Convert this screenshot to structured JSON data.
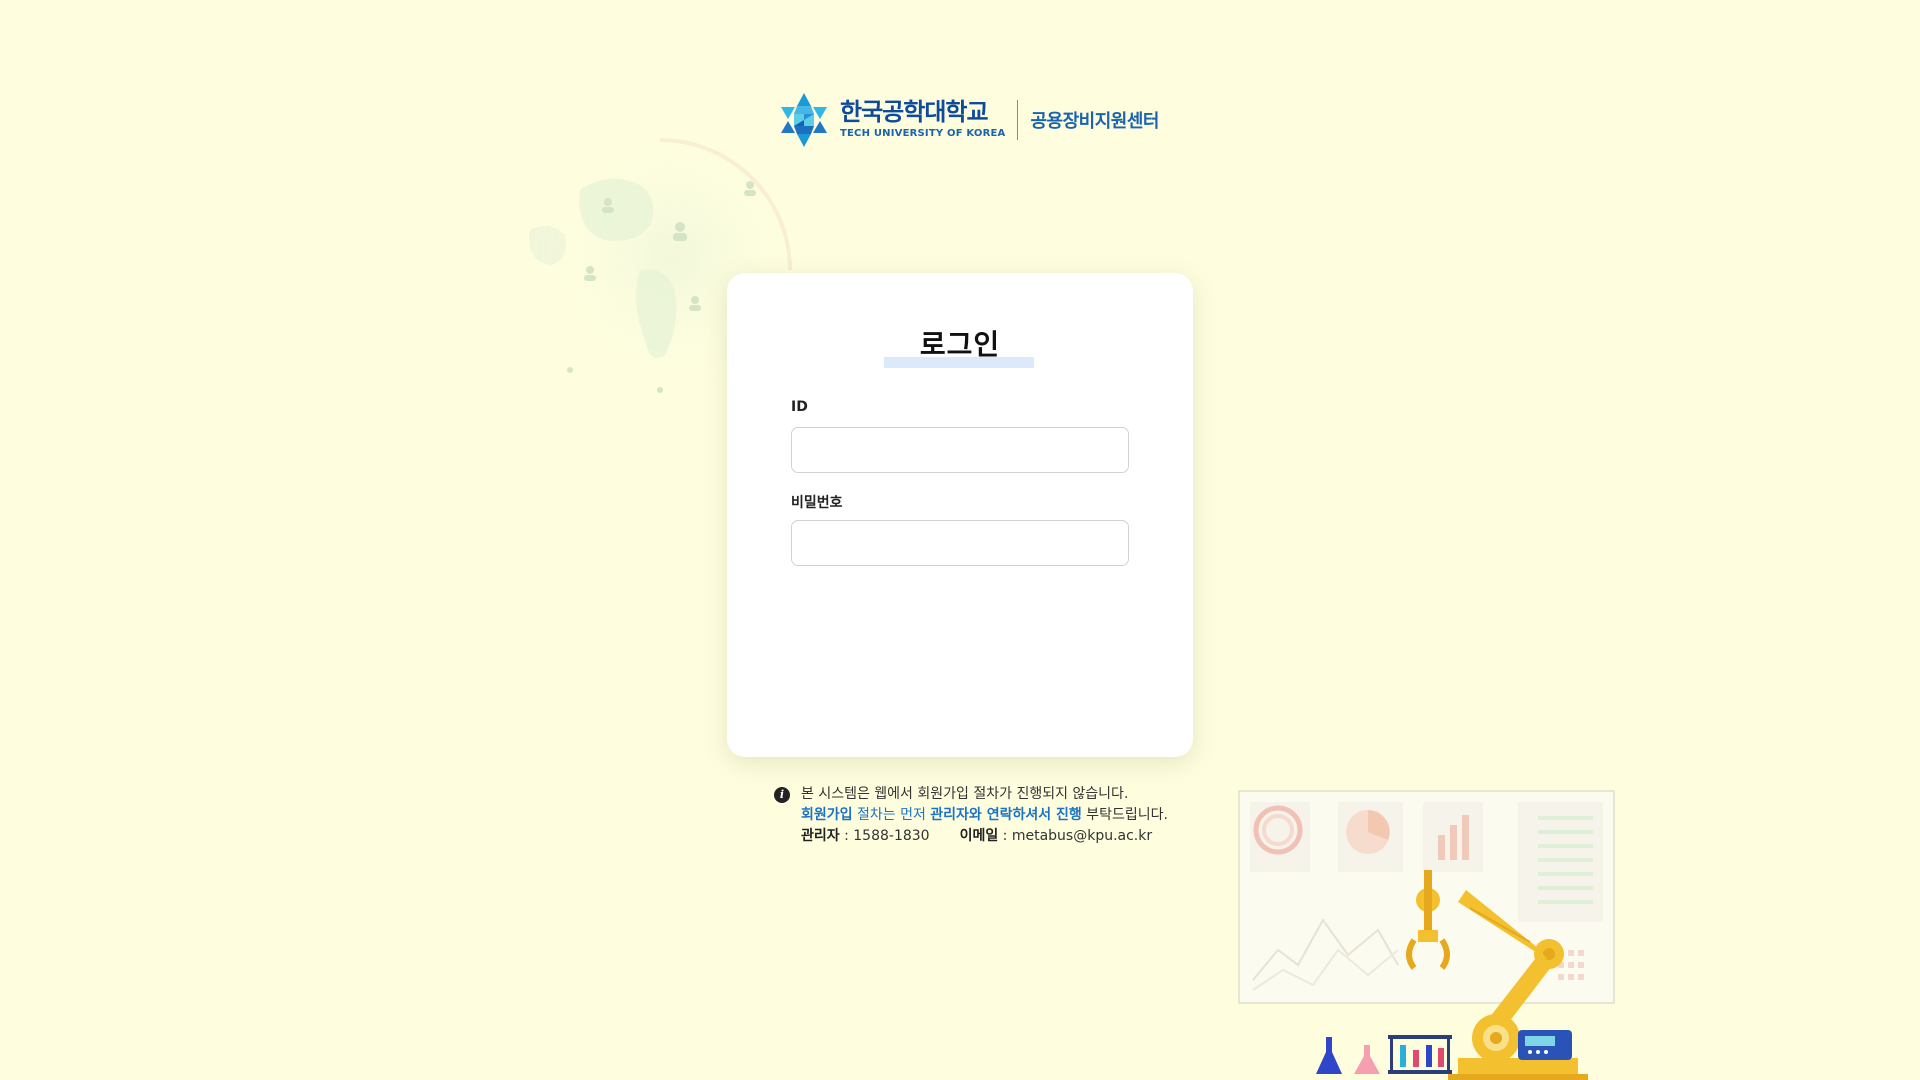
{
  "header": {
    "university_name": "한국공학대학교",
    "university_english": "TECH UNIVERSITY OF KOREA",
    "center_name": "공용장비지원센터"
  },
  "login": {
    "title": "로그인",
    "id_label": "ID",
    "id_value": "",
    "password_label": "비밀번호",
    "password_value": ""
  },
  "notice": {
    "line1": "본 시스템은 웹에서 회원가입 절차가 진행되지 않습니다.",
    "line2_a": "회원가입",
    "line2_b": " 절차는 먼저 ",
    "line2_c": "관리자와 연락하셔서 진행",
    "line2_d": " 부탁드립니다.",
    "admin_label": "관리자",
    "admin_phone": " : 1588-1830",
    "email_label": "이메일",
    "email_value": " : metabus@kpu.ac.kr"
  },
  "colors": {
    "background": "#fefedf",
    "brand_blue": "#0f4b9c",
    "accent_blue": "#1a73c8",
    "robot_yellow": "#f3c12f"
  }
}
